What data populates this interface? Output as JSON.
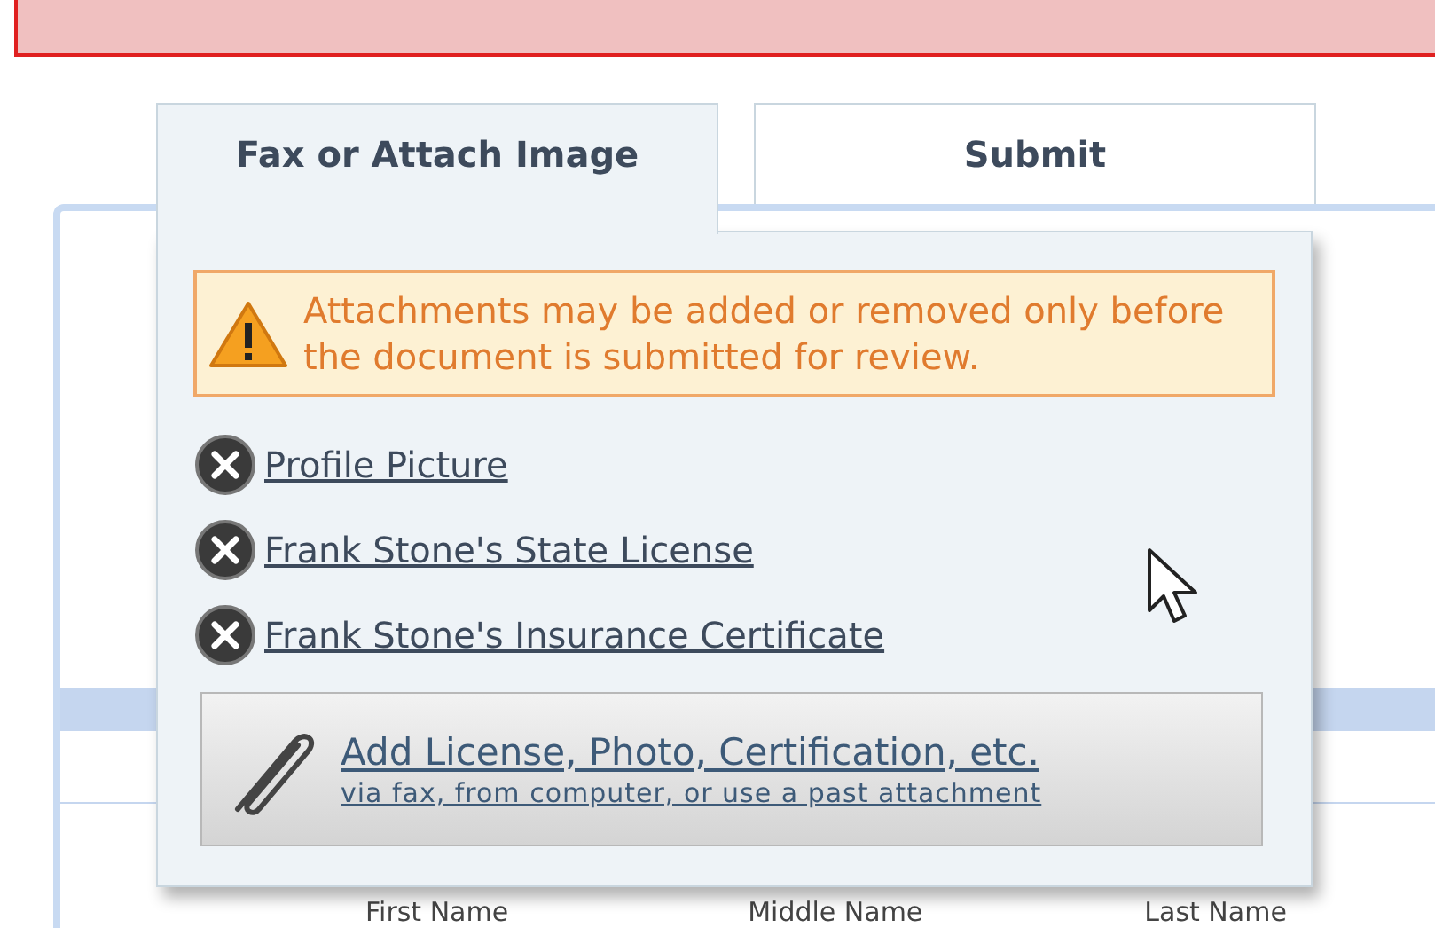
{
  "tabs": [
    {
      "label": "Fax or Attach Image",
      "selected": true
    },
    {
      "label": "Submit",
      "selected": false
    }
  ],
  "warning": {
    "text": "Attachments may be added or removed only before the document is submitted for review."
  },
  "attachments": [
    {
      "name": "Profile Picture"
    },
    {
      "name": "Frank Stone's State License"
    },
    {
      "name": "Frank Stone's Insurance Certificate"
    }
  ],
  "add_button": {
    "title": "Add License, Photo, Certification, etc.",
    "subtitle": "via fax, from computer, or use a past attachment"
  },
  "field_labels": [
    "First Name",
    "Middle Name",
    "Last Name"
  ]
}
